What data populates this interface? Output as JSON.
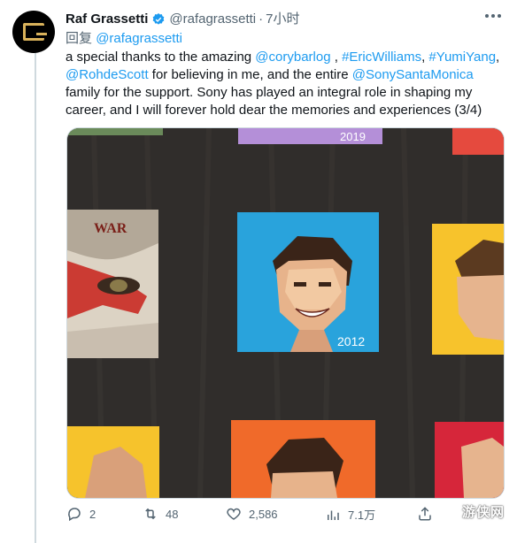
{
  "tweet": {
    "author_name": "Raf Grassetti",
    "author_handle": "@rafagrassetti",
    "separator": "·",
    "time": "7小时",
    "reply_prefix": "回复",
    "reply_handle": "@rafagrassetti",
    "body": [
      {
        "t": "a special thanks to the amazing ",
        "link": false
      },
      {
        "t": "@corybarlog",
        "link": true
      },
      {
        "t": " , ",
        "link": false
      },
      {
        "t": "#EricWilliams",
        "link": true
      },
      {
        "t": ", ",
        "link": false
      },
      {
        "t": "#YumiYang",
        "link": true
      },
      {
        "t": ", ",
        "link": false
      },
      {
        "t": "@RohdeScott",
        "link": true
      },
      {
        "t": " for believing in me, and the entire ",
        "link": false
      },
      {
        "t": "@SonySantaMonica",
        "link": true
      },
      {
        "t": " family for the support. Sony has played an integral role in shaping my career, and I will forever hold dear the memories and experiences (3/4)",
        "link": false
      }
    ],
    "photo": {
      "year_top": "2019",
      "year_center": "2012",
      "art_text": "WAR"
    },
    "stats": {
      "replies": "2",
      "retweets": "48",
      "likes": "2,586",
      "views": "7.1万"
    }
  },
  "watermark": "游侠网",
  "colors": {
    "link": "#1d9bf0",
    "muted": "#536471",
    "accent": "#d9b25b"
  },
  "icons": [
    "verified-badge-icon",
    "more-icon",
    "reply-icon",
    "retweet-icon",
    "like-icon",
    "views-icon",
    "share-icon"
  ]
}
